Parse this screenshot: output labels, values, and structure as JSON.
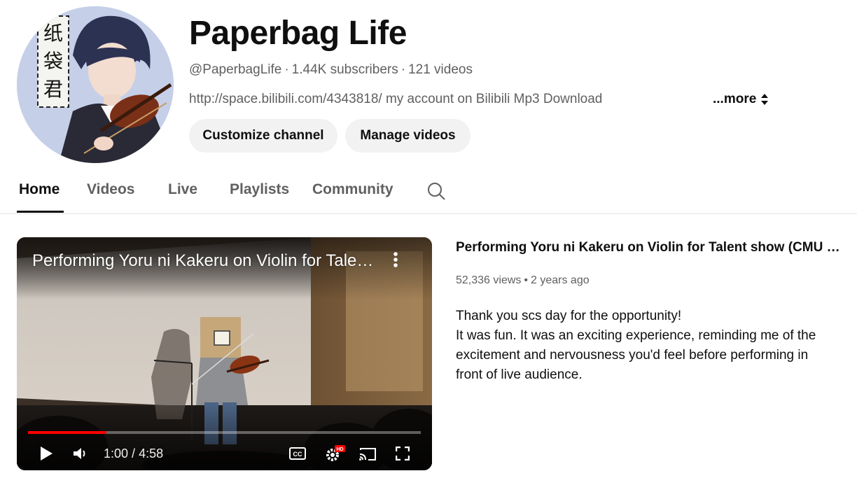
{
  "channel": {
    "name": "Paperbag Life",
    "handle": "@PaperbagLife",
    "subscribers": "1.44K subscribers",
    "videos_count": "121 videos",
    "description": "http://space.bilibili.com/4343818/ my account on Bilibili Mp3 Download",
    "more_label": "...more",
    "avatar_text": [
      "纸",
      "袋",
      "君"
    ]
  },
  "buttons": {
    "customize": "Customize channel",
    "manage": "Manage videos"
  },
  "tabs": [
    {
      "label": "Home",
      "active": true
    },
    {
      "label": "Videos",
      "active": false
    },
    {
      "label": "Live",
      "active": false
    },
    {
      "label": "Playlists",
      "active": false
    },
    {
      "label": "Community",
      "active": false
    }
  ],
  "player": {
    "title": "Performing Yoru ni Kakeru on Violin for Talent show (CMU SCS Day)",
    "time_current": "1:00",
    "time_total": "4:58",
    "progress": 0.2,
    "quality_badge": "HD"
  },
  "featured": {
    "title": "Performing Yoru ni Kakeru on Violin for Talent show (CMU SCS Day)",
    "views": "52,336 views",
    "age": "2 years ago",
    "description": [
      "Thank you scs day for the opportunity!",
      "It was fun. It was an exciting experience, reminding me of the excitement and nervousness you'd feel before performing in front of live audience."
    ]
  },
  "colors": {
    "text_primary": "#0f0f0f",
    "text_secondary": "#606060",
    "button_bg": "#f2f2f2",
    "progress_red": "#ff0000"
  },
  "icons": [
    "search-icon",
    "sort-arrows-icon",
    "kebab-menu-icon",
    "play-icon",
    "volume-icon",
    "captions-icon",
    "settings-icon",
    "cast-icon",
    "fullscreen-icon"
  ]
}
